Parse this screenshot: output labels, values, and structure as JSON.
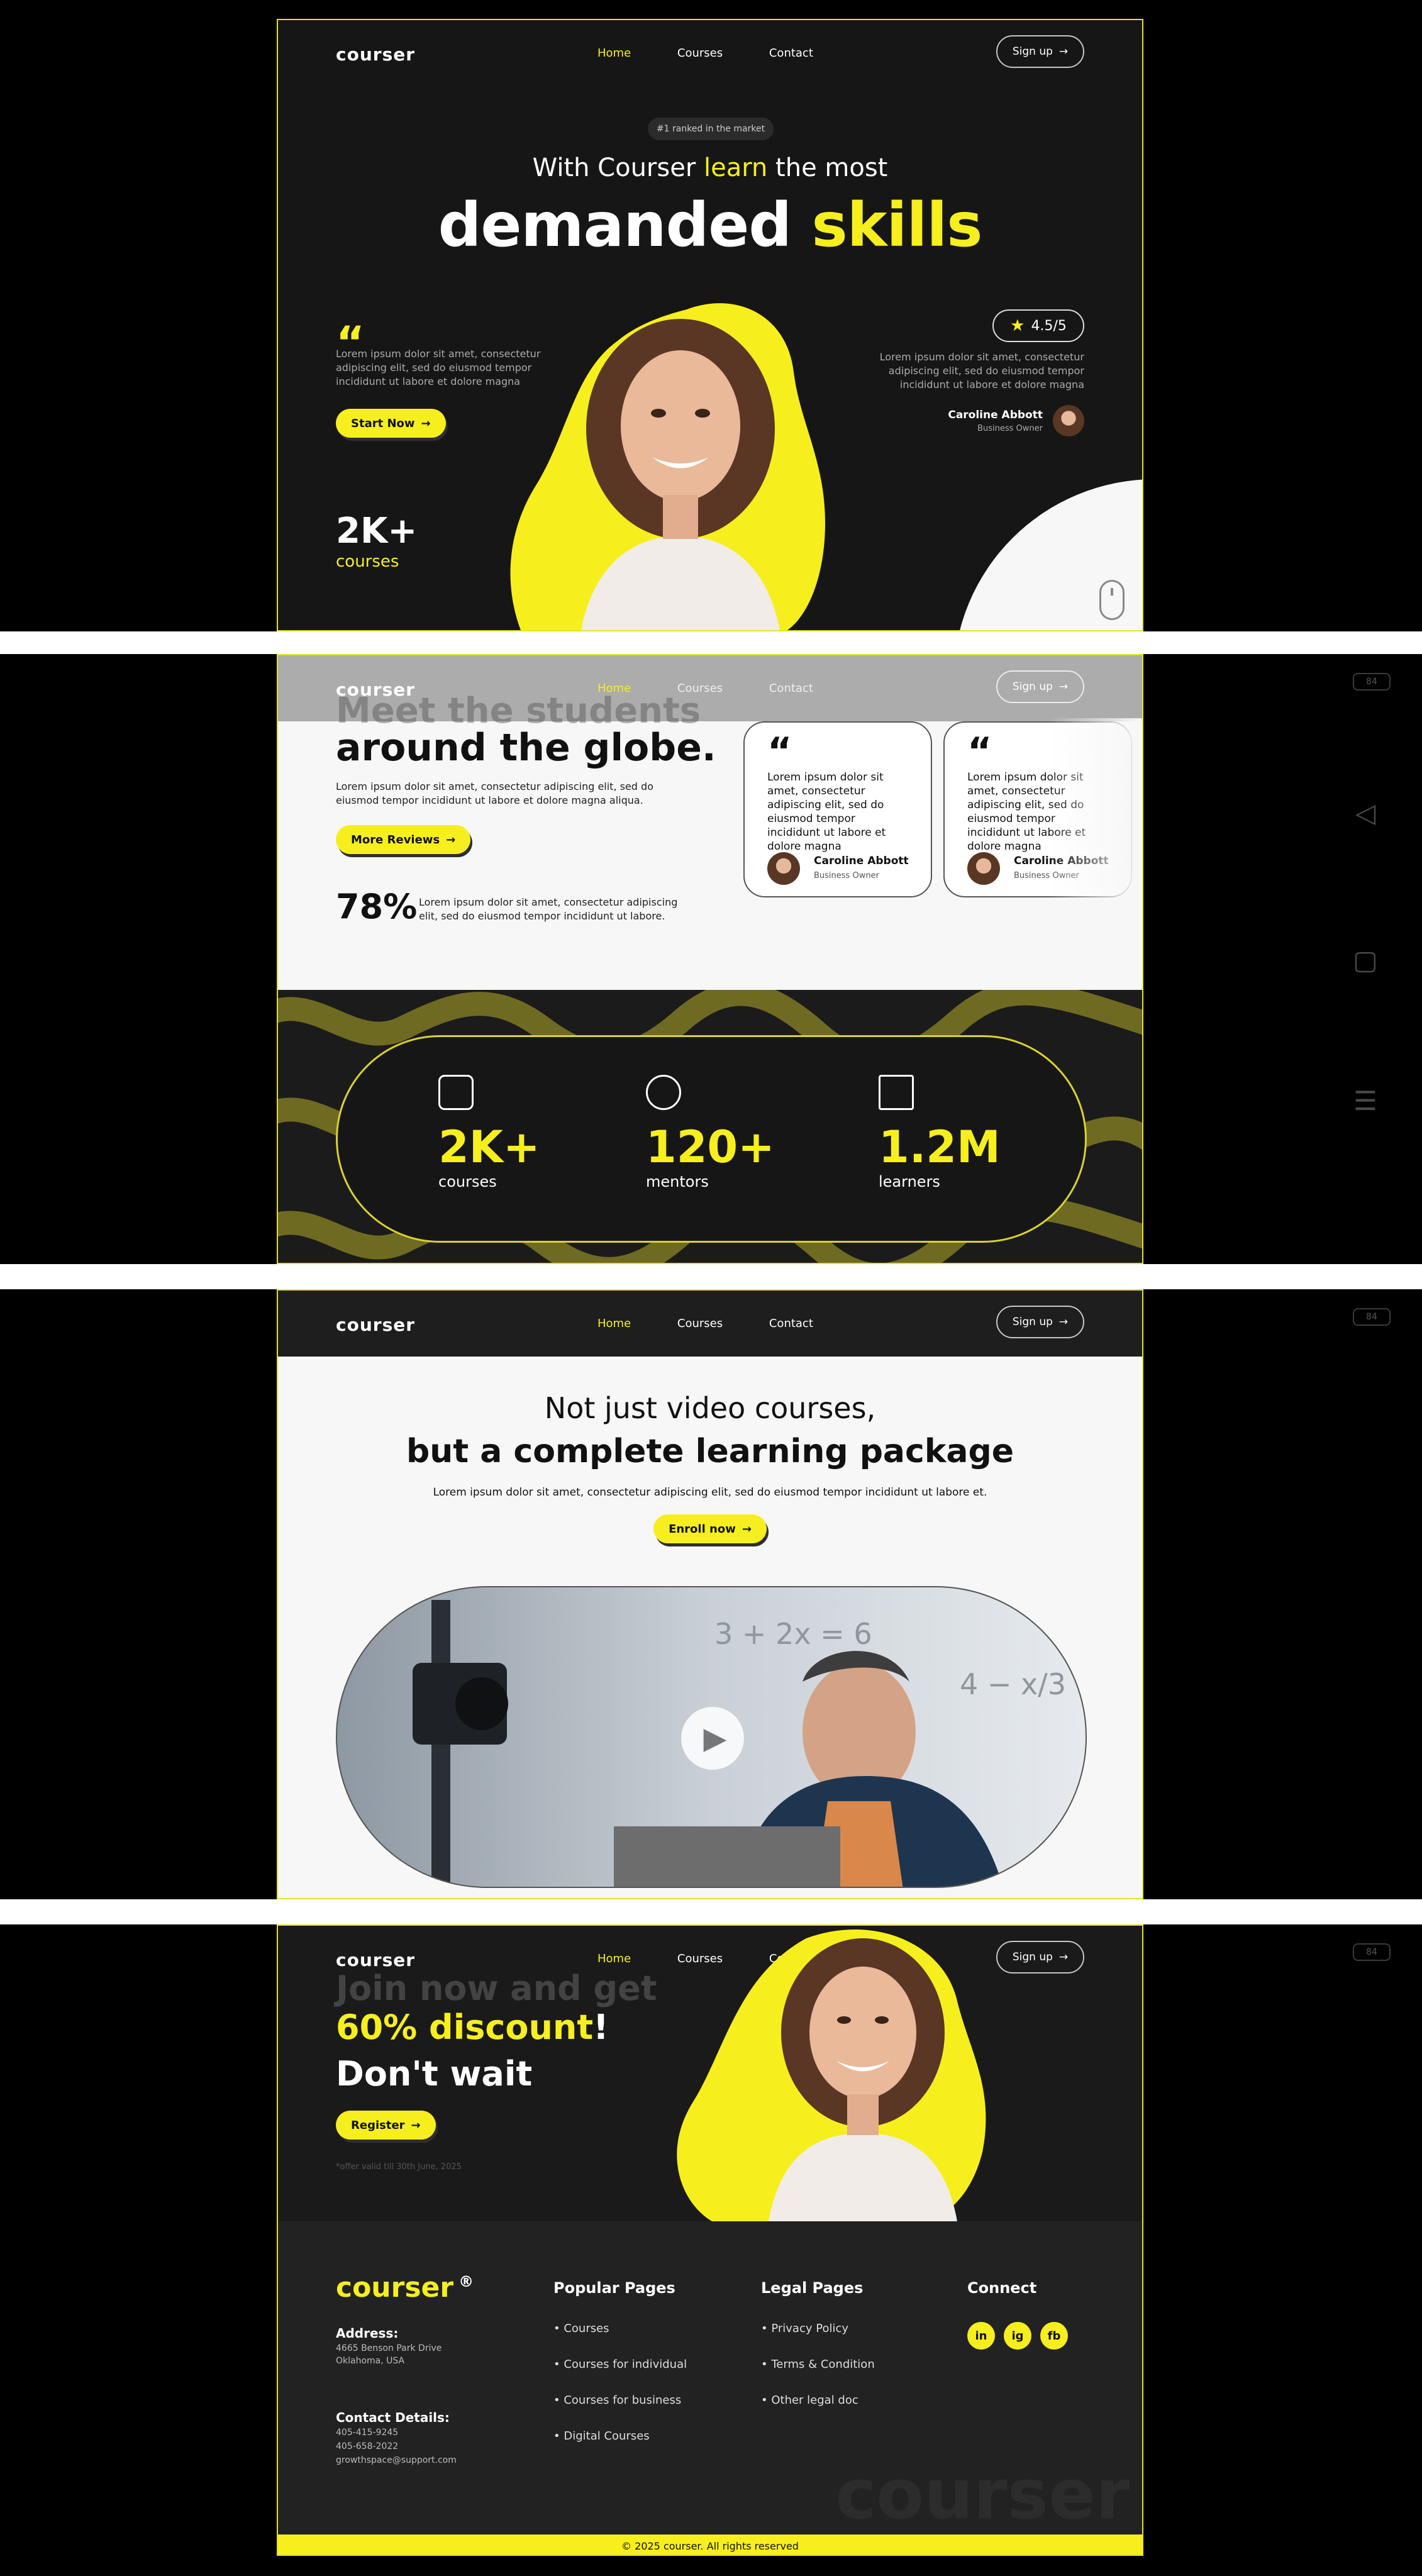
{
  "nav": {
    "logo": "courser",
    "links": [
      "Home",
      "Courses",
      "Contact"
    ],
    "signup": "Sign up"
  },
  "hero": {
    "badge": "#1 ranked in the market",
    "line1_pre": "With Courser ",
    "line1_accent": "learn",
    "line1_post": " the most",
    "line2_main": "demanded ",
    "line2_accent": "skills",
    "quote_text": "Lorem ipsum dolor sit amet, consectetur adipiscing elit, sed do eiusmod tempor incididunt ut labore et dolore magna",
    "start_button": "Start Now",
    "rating": "4.5/5",
    "review_text": "Lorem ipsum dolor sit amet, consectetur adipiscing elit, sed do eiusmod tempor incididunt ut labore et dolore magna",
    "reviewer_name": "Caroline Abbott",
    "reviewer_role": "Business Owner",
    "stat_value": "2K+",
    "stat_label": "courses"
  },
  "reviews": {
    "title_faded": "Meet the students",
    "title": "around the globe.",
    "text": "Lorem ipsum dolor sit amet, consectetur adipiscing elit, sed do eiusmod tempor incididunt ut labore et dolore magna aliqua.",
    "button": "More Reviews",
    "percent": "78%",
    "percent_text": "Lorem ipsum dolor sit amet, consectetur adipiscing elit, sed do eiusmod tempor incididunt ut labore.",
    "cards": [
      {
        "text": "Lorem ipsum dolor sit amet, consectetur adipiscing elit, sed do eiusmod tempor incididunt ut labore et dolore magna",
        "name": "Caroline Abbott",
        "role": "Business Owner"
      },
      {
        "text": "Lorem ipsum dolor sit amet, consectetur adipiscing elit, sed do eiusmod tempor incididunt ut labore et dolore magna",
        "name": "Caroline Abbott",
        "role": "Business Owner"
      }
    ]
  },
  "stats": [
    {
      "value": "2K+",
      "label": "courses",
      "icon": "graduation-icon"
    },
    {
      "value": "120+",
      "label": "mentors",
      "icon": "mentor-icon"
    },
    {
      "value": "1.2M",
      "label": "learners",
      "icon": "book-icon"
    }
  ],
  "package": {
    "line1": "Not just video courses,",
    "line2": "but a complete learning package",
    "text": "Lorem ipsum dolor sit amet, consectetur adipiscing elit, sed do eiusmod tempor incididunt ut labore et.",
    "button": "Enroll now"
  },
  "discount": {
    "faded": "Join now and get",
    "accent": "60% discount",
    "bang": "!",
    "line2": "Don't wait",
    "button": "Register",
    "note": "*offer valid till 30th June, 2025"
  },
  "footer": {
    "logo": "courser",
    "reg": "®",
    "address_label": "Address:",
    "address_lines": [
      "4665 Benson Park Drive",
      "Oklahoma, USA"
    ],
    "contact_label": "Contact Details:",
    "contact_lines": [
      "405-415-9245",
      "405-658-2022",
      "growthspace@support.com"
    ],
    "popular_title": "Popular Pages",
    "popular_links": [
      "Courses",
      "Courses for individual",
      "Courses for business",
      "Digital Courses"
    ],
    "legal_title": "Legal Pages",
    "legal_links": [
      "Privacy Policy",
      "Terms & Condition",
      "Other legal doc"
    ],
    "connect_title": "Connect",
    "social": [
      "in",
      "ig",
      "fb"
    ],
    "watermark": "courser",
    "copyright": "© 2025 courser. All rights reserved"
  },
  "system": {
    "badge": "84"
  },
  "colors": {
    "accent": "#f6ef1d",
    "dark": "#161616",
    "light": "#f7f7f7"
  }
}
